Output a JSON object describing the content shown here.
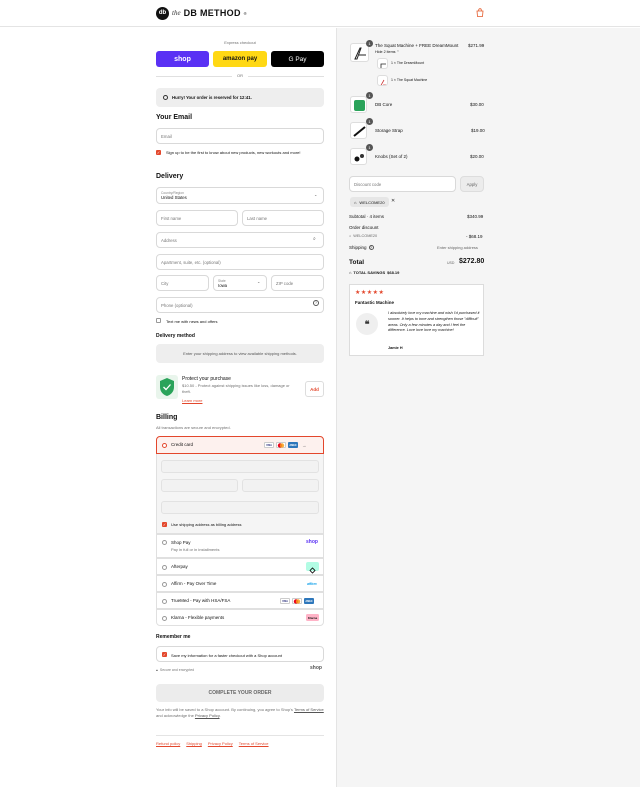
{
  "header": {
    "brand_the": "the",
    "brand_name": "DB METHOD",
    "brand_mark": "db",
    "trademark": "®"
  },
  "express": {
    "label": "Express checkout",
    "shop": "shop",
    "amazon": "amazon pay",
    "gpay": "G Pay",
    "or": "OR"
  },
  "reserve": {
    "text": "Hurry! Your order is reserved for 12:41."
  },
  "contact": {
    "heading": "Your Email",
    "email_placeholder": "Email",
    "signup": "Sign up to be the first to know about new products, new workouts and more!"
  },
  "delivery": {
    "heading": "Delivery",
    "country_label": "Country/Region",
    "country_value": "United States",
    "first": "First name",
    "last": "Last name",
    "address": "Address",
    "apt": "Apartment, suite, etc. (optional)",
    "city": "City",
    "state_label": "State",
    "state_value": "Iowa",
    "zip": "ZIP code",
    "phone": "Phone (optional)",
    "text_me": "Text me with news and offers",
    "method_heading": "Delivery method",
    "method_note": "Enter your shipping address to view available shipping methods."
  },
  "protect": {
    "title": "Protect your purchase",
    "desc": "$10.50 - Protect against shipping issues like loss, damage or theft.",
    "learn": "Learn more",
    "add": "Add"
  },
  "billing": {
    "heading": "Billing",
    "note": "All transactions are secure and encrypted.",
    "credit": "Credit card",
    "use_shipping": "Use shipping address as billing address",
    "options": [
      {
        "label": "Shop Pay",
        "sub": "Pay in full or in installments",
        "logo": "shop"
      },
      {
        "label": "Afterpay",
        "sub": "",
        "logo": "afterpay"
      },
      {
        "label": "Affirm - Pay Over Time",
        "sub": "",
        "logo": "affirm"
      },
      {
        "label": "TrueMed - Pay with HSA/FSA",
        "sub": "",
        "logo": "cards"
      },
      {
        "label": "Klarna - Flexible payments",
        "sub": "",
        "logo": "Klarna"
      }
    ]
  },
  "remember": {
    "heading": "Remember me",
    "save": "Save my information for a faster checkout with a Shop account",
    "secure": "Secure and encrypted",
    "shop": "shop"
  },
  "complete": {
    "label": "COMPLETE YOUR ORDER"
  },
  "legal": {
    "text1": "Your info will be saved to a Shop account. By continuing, you agree to Shop's",
    "tos": "Terms of Service",
    "text2": "and acknowledge the",
    "privacy": "Privacy Policy",
    "period": "."
  },
  "footer": {
    "links": [
      "Refund policy",
      "Shipping",
      "Privacy Policy",
      "Terms of Service"
    ]
  },
  "summary": {
    "items": [
      {
        "name": "The Squat Machine + FREE DreamMount",
        "price": "$271.99",
        "qty": "1",
        "toggle": "Hide 2 items",
        "subs": [
          "1 × The DreamMount",
          "1 × The Squat Machine"
        ]
      },
      {
        "name": "DB Core",
        "price": "$30.00",
        "qty": "1"
      },
      {
        "name": "Storage Strap",
        "price": "$19.00",
        "qty": "1"
      },
      {
        "name": "Knobs (Set of 2)",
        "price": "$20.00",
        "qty": "1"
      }
    ],
    "discount_placeholder": "Discount code",
    "apply": "Apply",
    "code": "WELCOME20",
    "subtotal_label": "Subtotal · 4 items",
    "subtotal": "$340.99",
    "order_discount": "Order discount",
    "discount_code": "WELCOME20",
    "discount_value": "- $68.19",
    "shipping_label": "Shipping",
    "shipping_value": "Enter shipping address",
    "total_label": "Total",
    "currency": "USD",
    "total": "$272.80",
    "savings_label": "TOTAL SAVINGS",
    "savings": "$68.19"
  },
  "review": {
    "stars": "★★★★★",
    "title": "Fantastic Machine",
    "quote_mark": "❝",
    "body": "I absolutely love my machine and wish I'd purchased it sooner. It helps to tone and strengthen those \"difficult\" areas. Only a few minutes a day and I feel the difference. Love love love my machine!",
    "author": "Jamie H"
  },
  "colors": {
    "accent": "#e3472c",
    "shop": "#5a31f4",
    "amazon": "#ffd814",
    "rating": "#e3472c"
  }
}
